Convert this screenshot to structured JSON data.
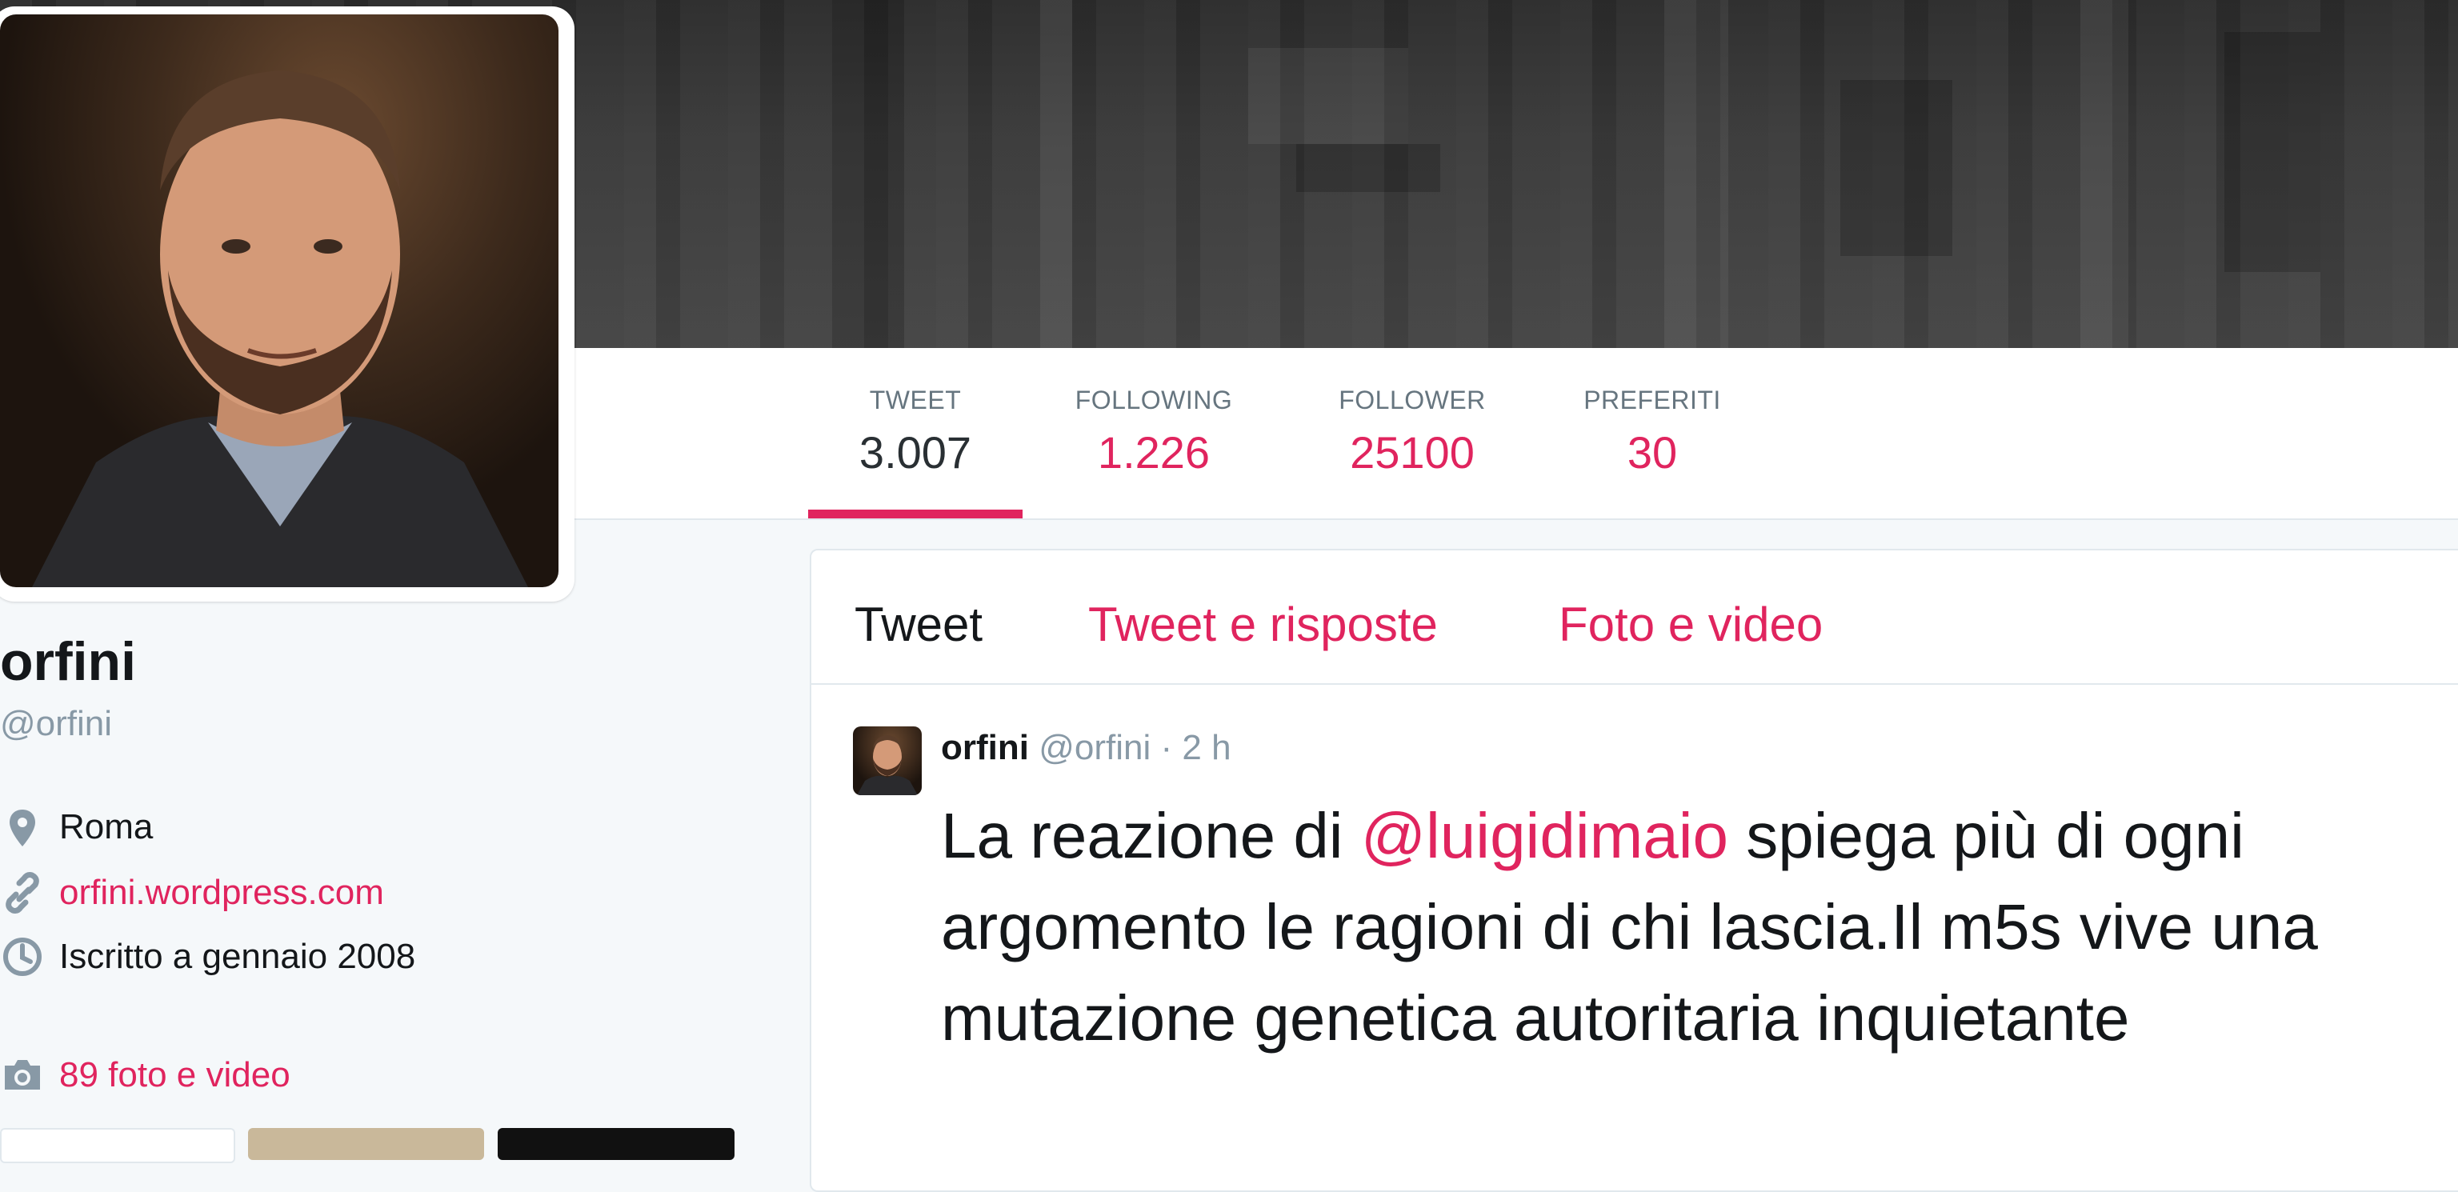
{
  "profile": {
    "name": "orfini",
    "handle": "@orfini",
    "location": "Roma",
    "website": "orfini.wordpress.com",
    "joined": "Iscritto a gennaio 2008",
    "media_count": "89 foto e video"
  },
  "stats": [
    {
      "label": "TWEET",
      "value": "3.007"
    },
    {
      "label": "FOLLOWING",
      "value": "1.226"
    },
    {
      "label": "FOLLOWER",
      "value": "25100"
    },
    {
      "label": "PREFERITI",
      "value": "30"
    }
  ],
  "timeline": {
    "tabs": [
      "Tweet",
      "Tweet e risposte",
      "Foto e video"
    ],
    "tweet": {
      "author_name": "orfini",
      "author_handle": "@orfini",
      "separator": "·",
      "time": "2 h",
      "text_before": "La reazione di ",
      "mention": "@luigidimaio",
      "text_after": " spiega più di ogni argomento le ragioni di chi lascia.Il m5s vive una mutazione genetica autoritaria inquietante"
    }
  },
  "colors": {
    "accent": "#e0245e",
    "text": "#14171a",
    "muted": "#8899a6",
    "background": "#f5f8fa"
  },
  "icons": [
    "map-pin-icon",
    "link-icon",
    "clock-icon",
    "camera-icon"
  ]
}
